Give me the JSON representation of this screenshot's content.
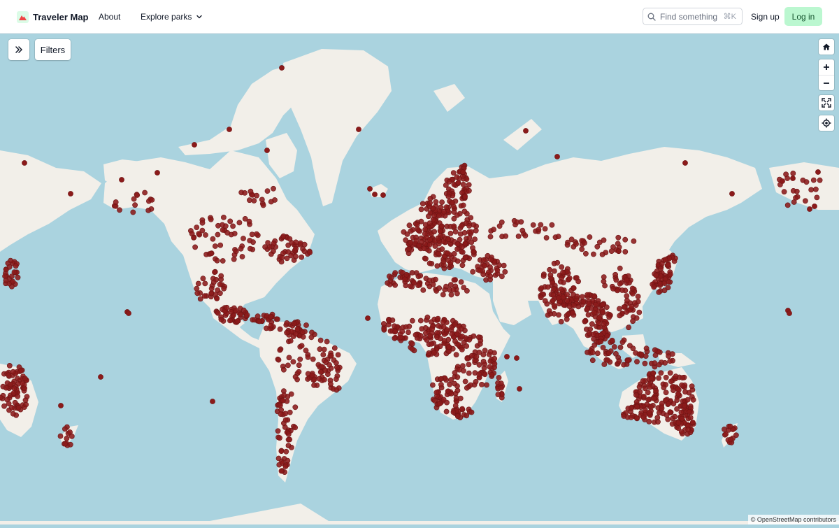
{
  "header": {
    "brand": "Traveler Map",
    "nav": {
      "about": "About",
      "explore": "Explore parks"
    },
    "search": {
      "placeholder": "Find something",
      "shortcut": "⌘K"
    },
    "signup": "Sign up",
    "login": "Log in"
  },
  "toolbar": {
    "filters_label": "Filters"
  },
  "map": {
    "colors": {
      "water": "#aad3df",
      "land": "#f2efe9",
      "marker": "#8b1a1a",
      "marker_stroke": "#6e1414",
      "brand_accent": "#bbf7d0"
    },
    "controls": [
      "home-icon",
      "zoom-in-icon",
      "zoom-out-icon",
      "fullscreen-icon",
      "locate-icon"
    ],
    "marker_symbol": "circle",
    "attribution": "© OpenStreetMap contributors"
  }
}
